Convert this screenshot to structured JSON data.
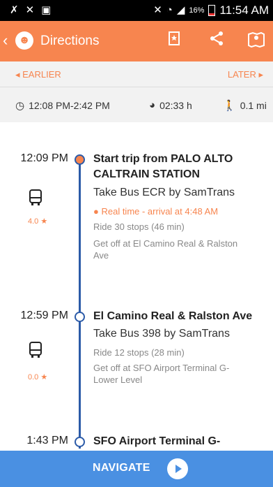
{
  "status_bar": {
    "left_icons": [
      "missed-call-icon",
      "x-icon",
      "image-icon"
    ],
    "battery_pct": "16%",
    "time": "11:54 AM"
  },
  "app_bar": {
    "back_glyph": "‹",
    "title": "Directions",
    "actions": [
      "bookmark-icon",
      "share-icon",
      "map-icon"
    ]
  },
  "nav": {
    "earlier": "EARLIER",
    "later": "LATER"
  },
  "summary": {
    "time_range": "12:08 PM-2:42 PM",
    "duration": "02:33 h",
    "walk": "0.1 mi"
  },
  "steps": [
    {
      "time": "12:09 PM",
      "title_line1": "Start trip from PALO ALTO",
      "title_line2": "CALTRAIN STATION",
      "take": "Take Bus ECR by SamTrans",
      "realtime": "Real time - arrival at 4:48 AM",
      "ride": "Ride 30 stops (46  min)",
      "getoff_line1": "Get off at El Camino Real & Ralston",
      "getoff_line2": "Ave",
      "rating": "4.0"
    },
    {
      "time": "12:59 PM",
      "title_line1": "El Camino Real & Ralston Ave",
      "take": "Take Bus 398 by SamTrans",
      "ride": "Ride 12 stops (28  min)",
      "getoff_line1": "Get off at SFO Airport Terminal G-",
      "getoff_line2": "Lower Level",
      "rating": "0.0"
    },
    {
      "time": "1:43 PM",
      "title_line1": "SFO Airport Terminal G-"
    }
  ],
  "footer": {
    "navigate": "NAVIGATE"
  },
  "colors": {
    "accent": "#f7854f",
    "timeline": "#2c5ba8",
    "navigate_bg": "#4a90e2"
  }
}
